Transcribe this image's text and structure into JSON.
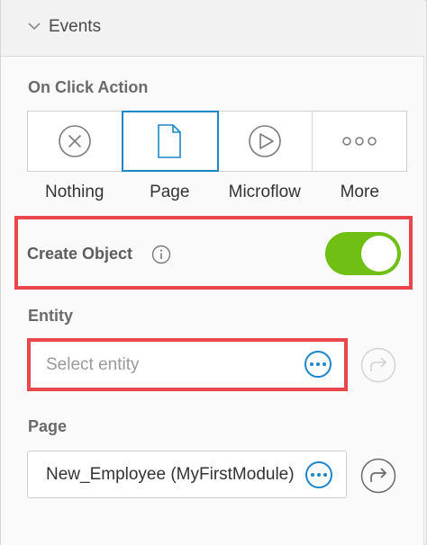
{
  "section": {
    "title": "Events"
  },
  "on_click": {
    "label": "On Click Action",
    "options": [
      {
        "label": "Nothing",
        "icon": "x-circle-icon"
      },
      {
        "label": "Page",
        "icon": "page-icon"
      },
      {
        "label": "Microflow",
        "icon": "play-circle-icon"
      },
      {
        "label": "More",
        "icon": "more-icon"
      }
    ],
    "selected": "Page"
  },
  "create_object": {
    "label": "Create Object",
    "enabled": true
  },
  "entity": {
    "label": "Entity",
    "placeholder": "Select entity"
  },
  "page": {
    "label": "Page",
    "value": "New_Employee (MyFirstModule)"
  },
  "colors": {
    "accent": "#1b86c9",
    "toggle_on": "#6fbf14",
    "highlight": "#e8474c"
  }
}
